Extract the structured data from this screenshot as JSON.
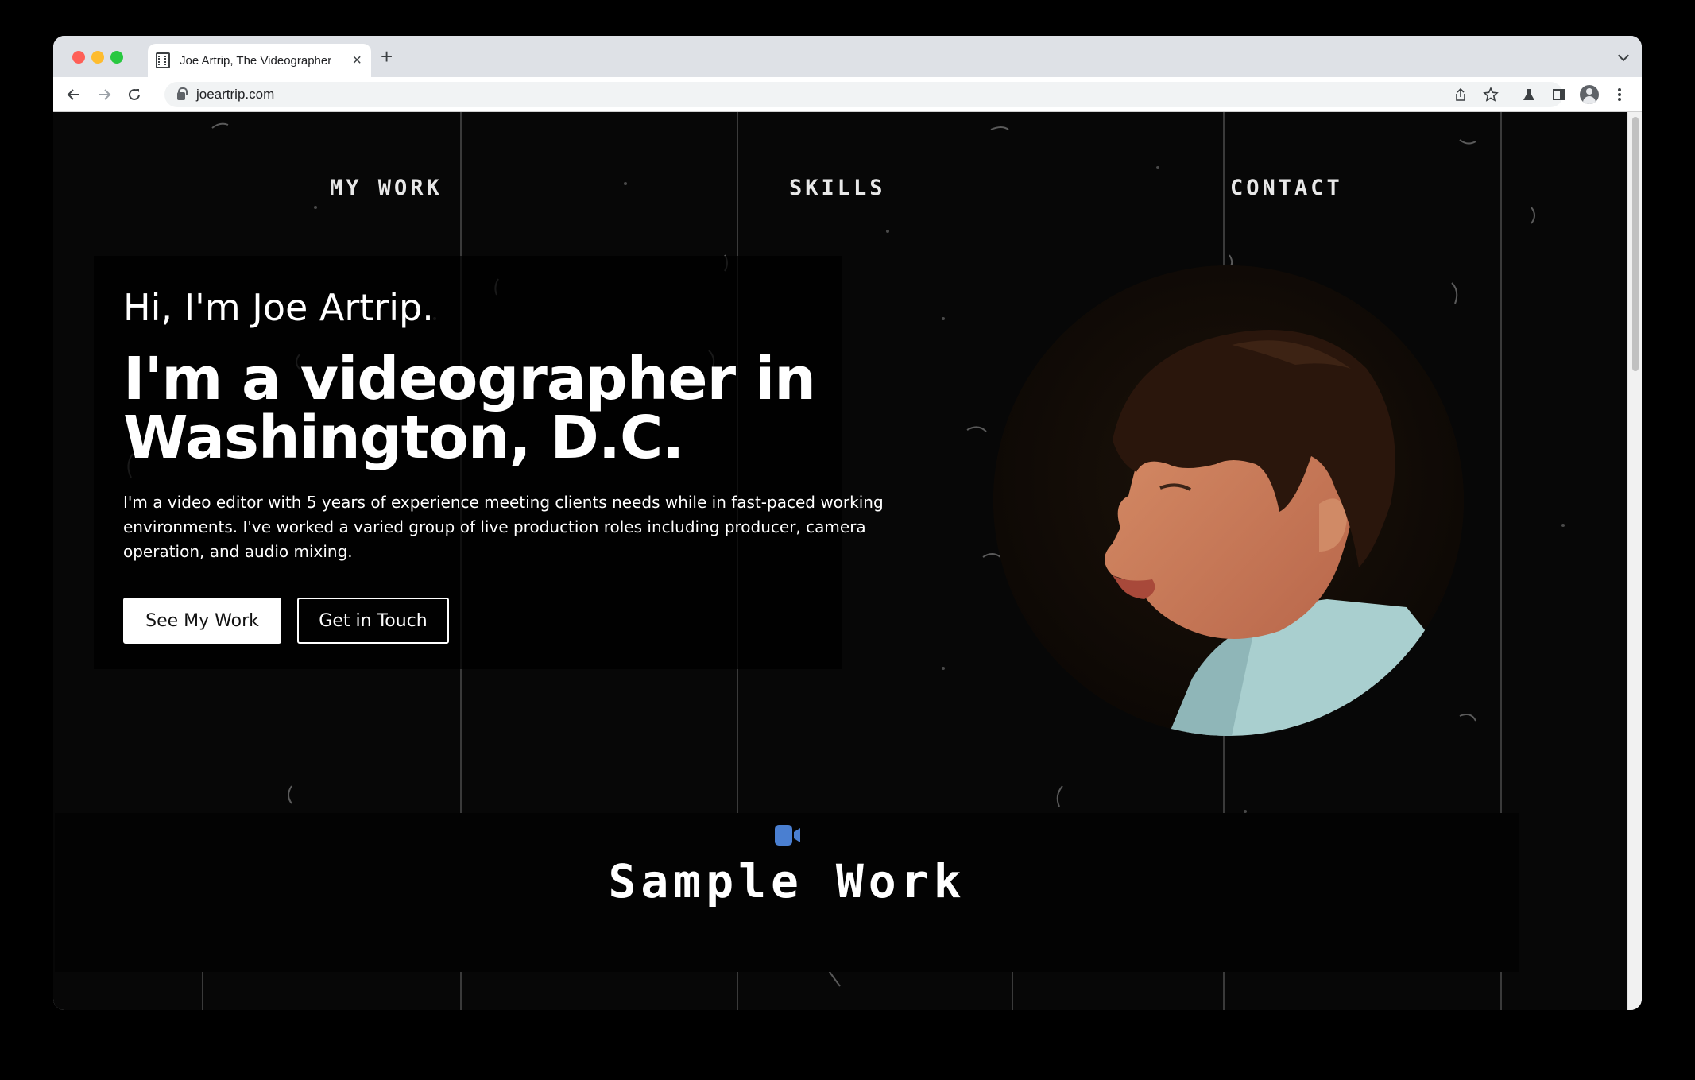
{
  "browser": {
    "tab_title": "Joe Artrip, The Videographer",
    "tab_close": "×",
    "new_tab": "+",
    "url": "joeartrip.com",
    "icons": [
      "back-arrow-icon",
      "forward-arrow-icon",
      "reload-icon",
      "lock-icon",
      "share-icon",
      "star-icon",
      "labs-flask-icon",
      "side-panel-icon",
      "profile-avatar-icon",
      "kebab-menu-icon"
    ]
  },
  "nav": {
    "my_work": "MY WORK",
    "skills": "SKILLS",
    "contact": "CONTACT"
  },
  "hero": {
    "greeting": "Hi, I'm Joe Artrip.",
    "headline": "I'm a videographer in Washington, D.C.",
    "bio": "I'm a video editor with 5 years of experience meeting clients needs while in fast-paced working environments. I've worked a varied group of live production roles including producer, camera operation, and audio mixing.",
    "primary_button": "See My Work",
    "secondary_button": "Get in Touch"
  },
  "samples": {
    "title": "Sample Work",
    "icon": "video-camera-icon",
    "icon_color": "#4a7fd1"
  },
  "colors": {
    "page_bg": "#070707",
    "text": "#ffffff",
    "button_fill": "#ffffff"
  }
}
